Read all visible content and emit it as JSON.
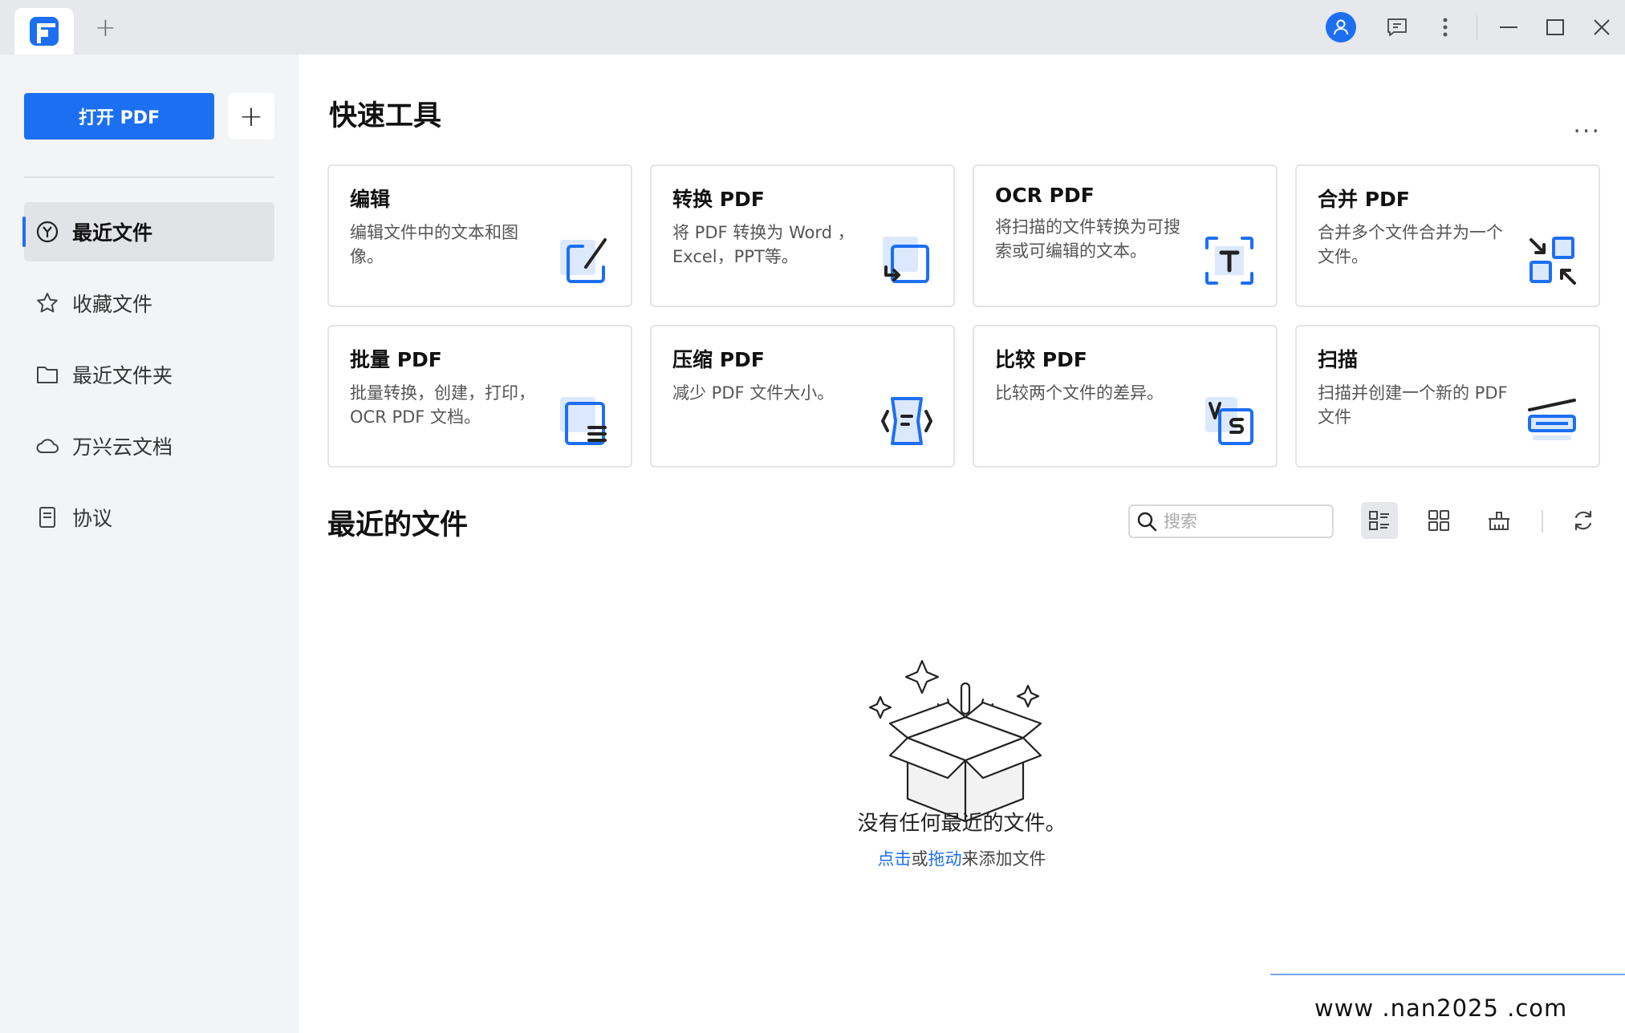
{
  "titlebar": {
    "new_tab": "+",
    "icons": [
      "user-icon",
      "feedback-icon",
      "more-vertical-icon",
      "minimize-icon",
      "maximize-icon",
      "close-icon"
    ]
  },
  "sidebar": {
    "open_button": "打开 PDF",
    "add_button": "+",
    "items": [
      {
        "label": "最近文件",
        "icon": "recent-icon",
        "active": true
      },
      {
        "label": "收藏文件",
        "icon": "star-icon"
      },
      {
        "label": "最近文件夹",
        "icon": "folder-icon"
      },
      {
        "label": "万兴云文档",
        "icon": "cloud-icon"
      },
      {
        "label": "协议",
        "icon": "document-icon"
      }
    ]
  },
  "quick_tools": {
    "title": "快速工具",
    "more": "...",
    "cards": [
      {
        "title": "编辑",
        "desc": "编辑文件中的文本和图像。",
        "icon": "edit-icon"
      },
      {
        "title": "转换 PDF",
        "desc": "将 PDF 转换为 Word ， Excel，PPT等。",
        "icon": "convert-icon"
      },
      {
        "title": "OCR PDF",
        "desc": "将扫描的文件转换为可搜索或可编辑的文本。",
        "icon": "ocr-icon"
      },
      {
        "title": "合并 PDF",
        "desc": "合并多个文件合并为一个文件。",
        "icon": "merge-icon"
      },
      {
        "title": "批量 PDF",
        "desc": "批量转换，创建，打印，OCR PDF 文档。",
        "icon": "batch-icon"
      },
      {
        "title": "压缩 PDF",
        "desc": "减少 PDF 文件大小。",
        "icon": "compress-icon"
      },
      {
        "title": "比较 PDF",
        "desc": "比较两个文件的差异。",
        "icon": "compare-icon"
      },
      {
        "title": "扫描",
        "desc": "扫描并创建一个新的 PDF 文件",
        "icon": "scan-icon"
      }
    ]
  },
  "recent": {
    "title": "最近的文件",
    "search_placeholder": "搜索",
    "empty_text": "没有任何最近的文件。",
    "hint_click": "点击",
    "hint_or": "或",
    "hint_drag": "拖动",
    "hint_rest": "来添加文件"
  },
  "watermark": "www .nan2025 .com",
  "colors": {
    "accent": "#1d6ff2",
    "sidebar_bg": "#f3f4f6",
    "titlebar_bg": "#e6e8eb"
  }
}
